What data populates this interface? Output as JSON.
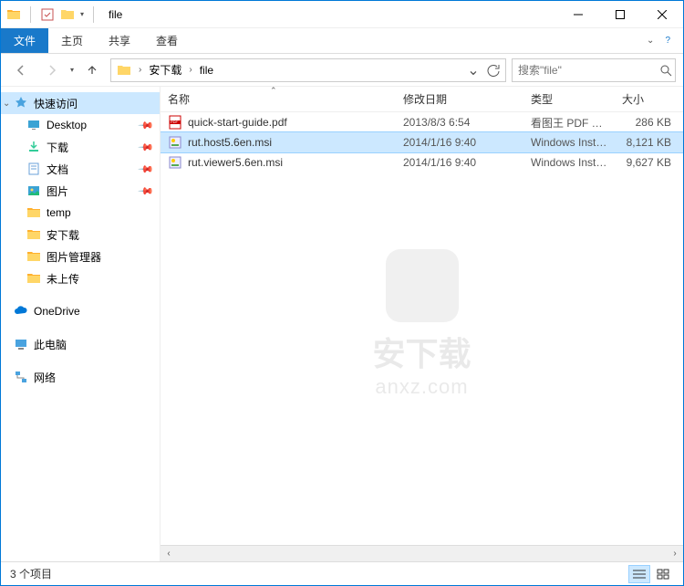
{
  "window": {
    "title": "file"
  },
  "ribbon": {
    "tabs": [
      "文件",
      "主页",
      "共享",
      "查看"
    ]
  },
  "breadcrumb": {
    "items": [
      "安下载",
      "file"
    ]
  },
  "search": {
    "placeholder": "搜索\"file\""
  },
  "sidebar": {
    "quick_access": "快速访问",
    "items": [
      {
        "label": "Desktop",
        "icon": "desktop",
        "pinned": true
      },
      {
        "label": "下载",
        "icon": "downloads",
        "pinned": true
      },
      {
        "label": "文档",
        "icon": "documents",
        "pinned": true
      },
      {
        "label": "图片",
        "icon": "pictures",
        "pinned": true
      },
      {
        "label": "temp",
        "icon": "folder",
        "pinned": false
      },
      {
        "label": "安下载",
        "icon": "folder",
        "pinned": false
      },
      {
        "label": "图片管理器",
        "icon": "folder",
        "pinned": false
      },
      {
        "label": "未上传",
        "icon": "folder",
        "pinned": false
      }
    ],
    "onedrive": "OneDrive",
    "thispc": "此电脑",
    "network": "网络"
  },
  "columns": {
    "name": "名称",
    "date": "修改日期",
    "type": "类型",
    "size": "大小"
  },
  "files": [
    {
      "name": "quick-start-guide.pdf",
      "date": "2013/8/3 6:54",
      "type": "看图王 PDF 文件",
      "size": "286 KB",
      "icon": "pdf",
      "selected": false
    },
    {
      "name": "rut.host5.6en.msi",
      "date": "2014/1/16 9:40",
      "type": "Windows Install...",
      "size": "8,121 KB",
      "icon": "msi",
      "selected": true
    },
    {
      "name": "rut.viewer5.6en.msi",
      "date": "2014/1/16 9:40",
      "type": "Windows Install...",
      "size": "9,627 KB",
      "icon": "msi",
      "selected": false
    }
  ],
  "statusbar": {
    "count": "3 个项目"
  },
  "watermark": {
    "line1": "安下载",
    "line2": "anxz.com"
  }
}
